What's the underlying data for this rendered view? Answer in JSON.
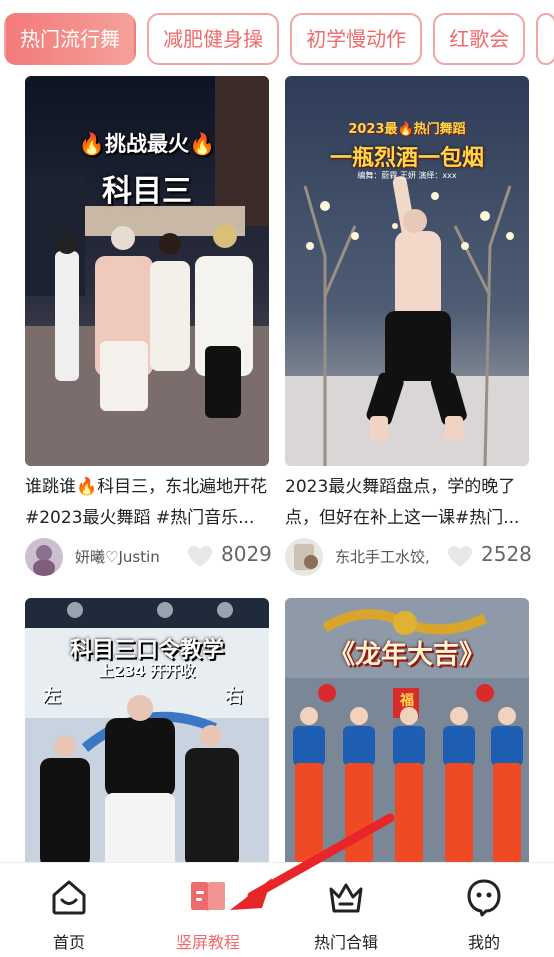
{
  "categories": [
    {
      "label": "热门流行舞",
      "active": true
    },
    {
      "label": "减肥健身操",
      "active": false
    },
    {
      "label": "初学慢动作",
      "active": false
    },
    {
      "label": "红歌会",
      "active": false
    }
  ],
  "videos": [
    {
      "overlay_lines": [
        "🔥挑战最火🔥",
        "科目三"
      ],
      "caption": "谁跳谁🔥科目三，东北遍地开花#2023最火舞蹈 #热门音乐...",
      "author": "妍曦♡Justin",
      "likes": "8029"
    },
    {
      "overlay_lines": [
        "2023最🔥热门舞蹈",
        "一瓶烈酒一包烟",
        "编舞：蔚霖 王妍 演绎：xxx"
      ],
      "caption": "2023最火舞蹈盘点，学的晚了点，但好在补上这一课#热门...",
      "author": "东北手工水饺,",
      "likes": "2528"
    },
    {
      "overlay_lines": [
        "科目三口令教学",
        "上234 开开收",
        "左",
        "右"
      ],
      "caption": "",
      "author": "",
      "likes": ""
    },
    {
      "overlay_lines": [
        "《龙年大吉》",
        "福"
      ],
      "caption": "",
      "author": "",
      "likes": ""
    }
  ],
  "bottom_nav": [
    {
      "label": "首页",
      "icon": "home-icon",
      "active": false
    },
    {
      "label": "竖屏教程",
      "icon": "book-icon",
      "active": true
    },
    {
      "label": "热门合辑",
      "icon": "crown-icon",
      "active": false
    },
    {
      "label": "我的",
      "icon": "profile-icon",
      "active": false
    }
  ],
  "colors": {
    "accent": "#ef6b6b",
    "chip_border": "#f2a6a6",
    "arrow": "#e8262a"
  }
}
